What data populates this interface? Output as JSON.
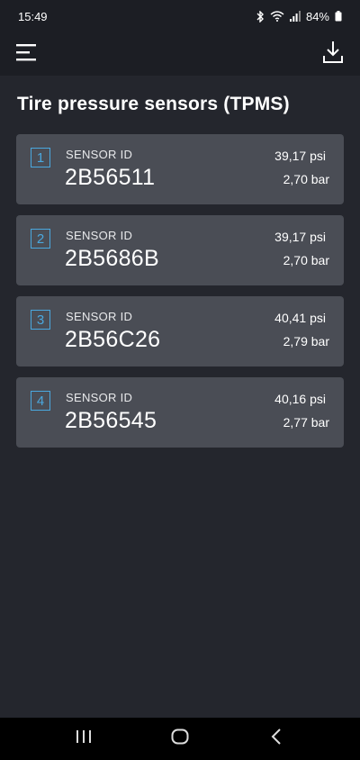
{
  "status_bar": {
    "time": "15:49",
    "battery": "84%",
    "icons": [
      "bluetooth-icon",
      "wifi-icon",
      "signal-icon",
      "battery-icon"
    ]
  },
  "app_bar": {
    "menu_icon": "menu-icon",
    "download_icon": "download-icon"
  },
  "page": {
    "title": "Tire pressure sensors (TPMS)"
  },
  "sensors": [
    {
      "index": "1",
      "label": "SENSOR ID",
      "id": "2B56511",
      "psi": "39,17 psi",
      "bar": "2,70 bar"
    },
    {
      "index": "2",
      "label": "SENSOR ID",
      "id": "2B5686B",
      "psi": "39,17 psi",
      "bar": "2,70 bar"
    },
    {
      "index": "3",
      "label": "SENSOR ID",
      "id": "2B56C26",
      "psi": "40,41 psi",
      "bar": "2,79 bar"
    },
    {
      "index": "4",
      "label": "SENSOR ID",
      "id": "2B56545",
      "psi": "40,16 psi",
      "bar": "2,77 bar"
    }
  ],
  "nav_bar": {
    "icons": [
      "recents-icon",
      "home-icon",
      "back-icon"
    ]
  },
  "colors": {
    "background": "#24262d",
    "bar_background": "#1c1e24",
    "card": "#4a4d55",
    "accent": "#4aa8df"
  }
}
